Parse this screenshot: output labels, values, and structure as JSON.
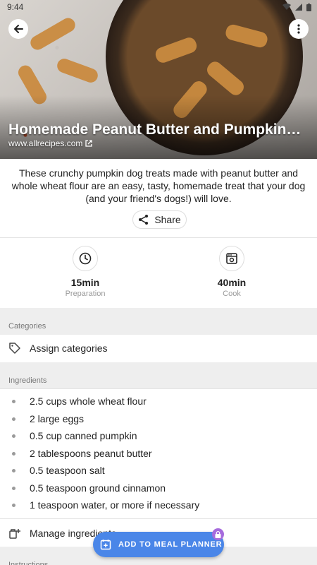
{
  "status_bar": {
    "time": "9:44"
  },
  "recipe": {
    "title": "Homemade Peanut Butter and Pumpkin…",
    "source": "www.allrecipes.com",
    "description": "These crunchy pumpkin dog treats made with peanut butter and whole wheat flour are an easy, tasty, homemade treat that your dog (and your friend's dogs!) will love.",
    "share_label": "Share"
  },
  "times": {
    "preparation": {
      "value": "15min",
      "label": "Preparation",
      "icon": "clock-icon"
    },
    "cook": {
      "value": "40min",
      "label": "Cook",
      "icon": "oven-icon"
    }
  },
  "categories": {
    "header": "Categories",
    "assign_label": "Assign categories"
  },
  "ingredients": {
    "header": "Ingredients",
    "items": [
      "2.5 cups whole wheat flour",
      "2 large eggs",
      "0.5 cup canned pumpkin",
      "2 tablespoons peanut butter",
      "0.5 teaspoon salt",
      "0.5 teaspoon ground cinnamon",
      "1 teaspoon water, or more if necessary"
    ],
    "manage_label": "Manage ingredients"
  },
  "instructions": {
    "header": "Instructions"
  },
  "fab": {
    "label": "ADD TO MEAL PLANNER"
  },
  "colors": {
    "accent": "#4a86e8",
    "lock_badge": "#a66bdd"
  }
}
